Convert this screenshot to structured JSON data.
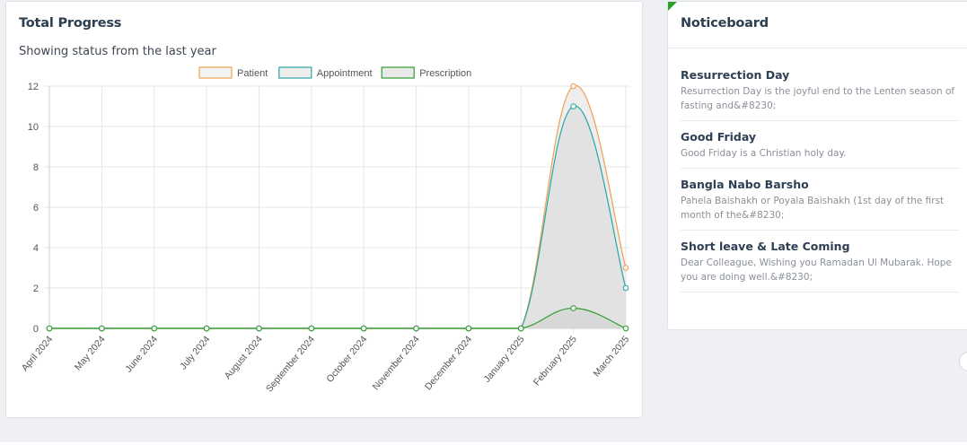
{
  "progress_card": {
    "title": "Total Progress",
    "subtitle": "Showing status from the last year"
  },
  "chart_data": {
    "type": "line",
    "x": [
      "April 2024",
      "May 2024",
      "June 2024",
      "July 2024",
      "August 2024",
      "September 2024",
      "October 2024",
      "November 2024",
      "December 2024",
      "January 2025",
      "February 2025",
      "March 2025"
    ],
    "series": [
      {
        "name": "Patient",
        "values": [
          0,
          0,
          0,
          0,
          0,
          0,
          0,
          0,
          0,
          0,
          12,
          3
        ],
        "color": "#f0a050",
        "fill": "#e8e8e8"
      },
      {
        "name": "Appointment",
        "values": [
          0,
          0,
          0,
          0,
          0,
          0,
          0,
          0,
          0,
          0,
          11,
          2
        ],
        "color": "#2aa5a5",
        "fill": "#dddddd"
      },
      {
        "name": "Prescription",
        "values": [
          0,
          0,
          0,
          0,
          0,
          0,
          0,
          0,
          0,
          0,
          1,
          0
        ],
        "color": "#2e9e2e",
        "fill": "#d4d4d4"
      }
    ],
    "ylim": [
      0,
      12
    ],
    "yticks": [
      "0",
      "2",
      "4",
      "6",
      "8",
      "10",
      "12"
    ],
    "grid": true,
    "legend_position": "top-center",
    "area_fill": true
  },
  "noticeboard": {
    "title": "Noticeboard",
    "items": [
      {
        "title": "Resurrection Day",
        "text": "Resurrection Day is the joyful end to the Lenten season of fasting and&#8230;"
      },
      {
        "title": "Good Friday",
        "text": "Good Friday is a Christian holy day."
      },
      {
        "title": "Bangla Nabo Barsho",
        "text": "Pahela Baishakh or Poyala Baishakh (1st day of the first month of the&#8230;"
      },
      {
        "title": "Short leave & Late Coming",
        "text": "Dear Colleague, Wishing you Ramadan Ul Mubarak. Hope you are doing well.&#8230;"
      }
    ]
  }
}
